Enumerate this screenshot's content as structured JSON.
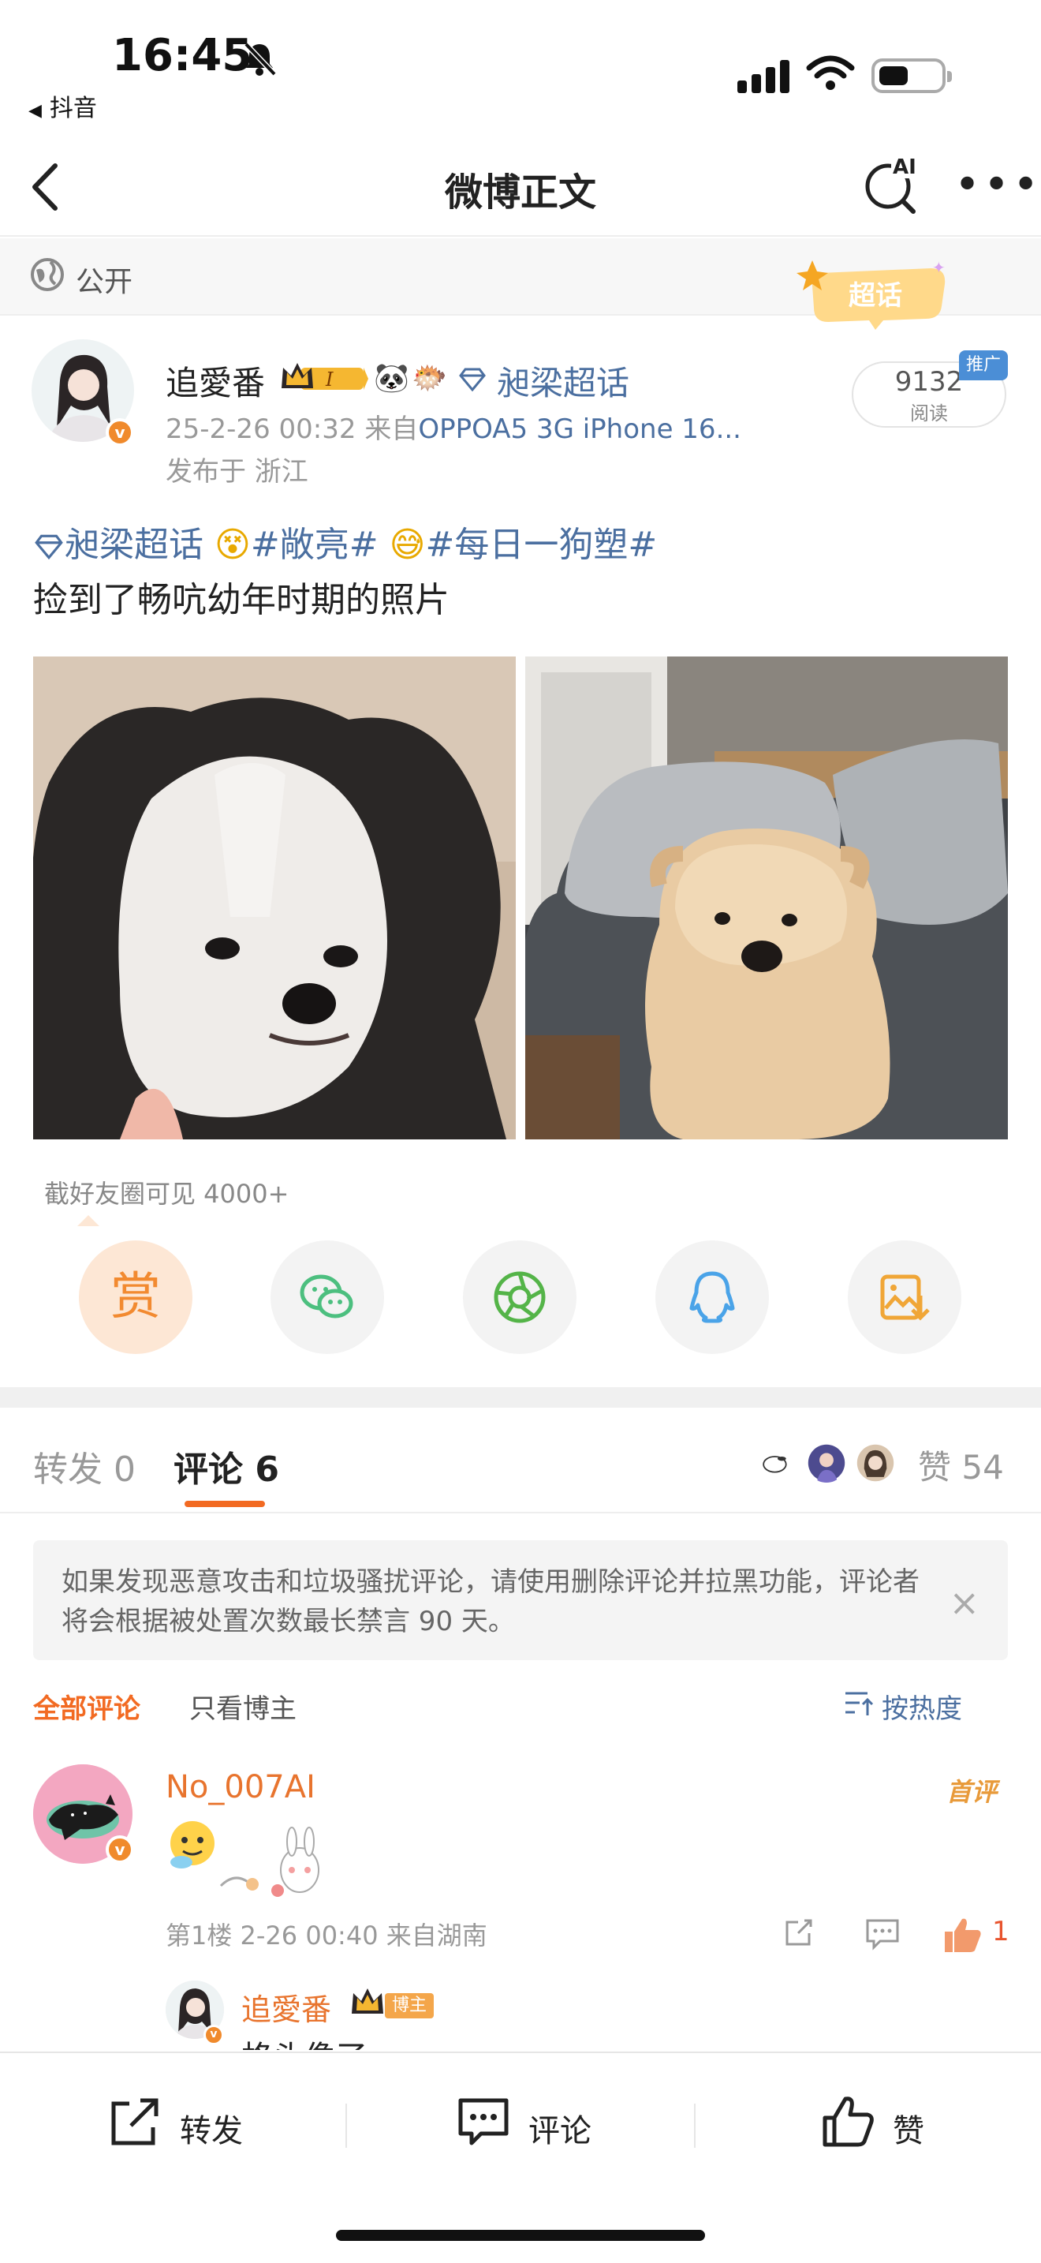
{
  "status": {
    "time": "16:45",
    "back_app": "抖音"
  },
  "nav": {
    "title": "微博正文",
    "ai_label": "AI"
  },
  "visibility": {
    "label": "公开",
    "chaohua_badge": "超话"
  },
  "post": {
    "author": {
      "name": "追愛番",
      "level_badge": "I",
      "topic": "昶梁超话",
      "verified_mark": "v"
    },
    "timestamp": "25-2-26 00:32",
    "source_prefix": "来自",
    "source": "OPPOA5 3G iPhone 16...",
    "location": "发布于 浙江",
    "reads": {
      "count": "9132",
      "label": "阅读"
    },
    "promo_label": "推广",
    "topics_line": {
      "topic1": "昶梁超话",
      "topic2": "#敞亮#",
      "topic3": "#每日一狗塑#"
    },
    "body": "捡到了畅吭幼年时期的照片"
  },
  "share": {
    "note": "截好友圈可见 4000+",
    "reward_label": "赏",
    "buttons": [
      "reward-button",
      "wechat-share-button",
      "moments-share-button",
      "qq-share-button",
      "save-image-button"
    ]
  },
  "tabs": {
    "repost": "转发 0",
    "comments": "评论 6",
    "likes": "赞 54"
  },
  "notice": {
    "text": "如果发现恶意攻击和垃圾骚扰评论，请使用删除评论并拉黑功能，评论者将会根据被处置次数最长禁言 90 天。",
    "close": "×"
  },
  "filters": {
    "all": "全部评论",
    "author_only": "只看博主",
    "sort": "按热度"
  },
  "comments": [
    {
      "name": "No_007AI",
      "first_label": "首评",
      "meta": "第1楼 2-26 00:40  来自湖南",
      "likes": "1",
      "reply": {
        "name": "追愛番",
        "author_badge": "博主",
        "text": "格头像了"
      }
    }
  ],
  "bottom_bar": {
    "repost": "转发",
    "comment": "评论",
    "like": "赞"
  },
  "colors": {
    "accent": "#f26a22",
    "link": "#4b6fa0",
    "meta": "#999999"
  }
}
